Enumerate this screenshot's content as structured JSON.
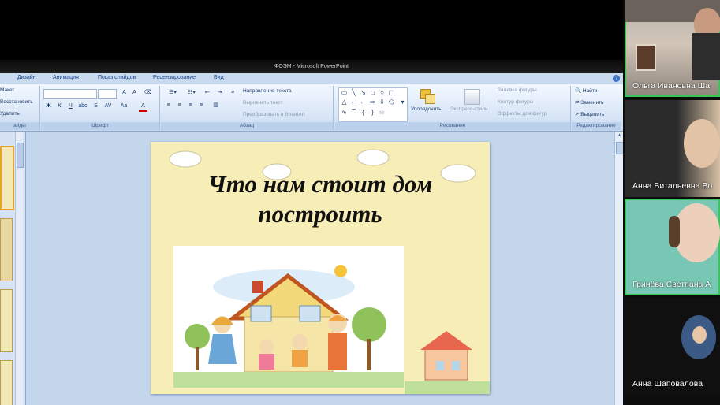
{
  "window": {
    "title": "ФОЭМ - Microsoft PowerPoint"
  },
  "tabs": [
    "Дизайн",
    "Анимация",
    "Показ слайдов",
    "Рецензирование",
    "Вид"
  ],
  "ribbon": {
    "slides_group": {
      "layout": "Макет",
      "reset": "Восстановить",
      "delete": "Удалить",
      "label": "айды"
    },
    "font_group": {
      "label": "Шрифт",
      "bold": "Ж",
      "italic": "К",
      "underline": "Ч",
      "strike": "abc",
      "shadow": "S",
      "spacing": "AV",
      "case": "Aa",
      "color": "A"
    },
    "paragraph_group": {
      "text_direction": "Направление текста",
      "align_text": "Выровнять текст",
      "convert_smartart": "Преобразовать в SmartArt",
      "label": "Абзац"
    },
    "drawing_group": {
      "arrange": "Упорядочить",
      "quick_styles": "Экспресс-стили",
      "shape_fill": "Заливка фигуры",
      "shape_outline": "Контур фигуры",
      "shape_effects": "Эффекты для фигур",
      "label": "Рисование"
    },
    "editing_group": {
      "find": "Найти",
      "replace": "Заменить",
      "select": "Выделить",
      "label": "Редактирование"
    }
  },
  "slide": {
    "title": "Что нам стоит дом построить"
  },
  "participants": [
    {
      "name": "Ольга Ивановна Ша",
      "active": true
    },
    {
      "name": "Анна Витальевна Во",
      "active": false
    },
    {
      "name": "Гринёва Светлана А",
      "active": true
    },
    {
      "name": "Анна Шаповалова",
      "active": false
    }
  ],
  "colors": {
    "active_speaker": "#39c55a",
    "ribbon_text": "#15428b",
    "slide_bg": "#f7edb7"
  }
}
